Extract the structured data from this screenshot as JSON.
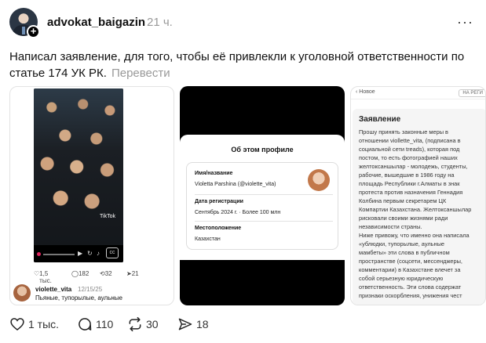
{
  "post": {
    "username": "advokat_baigazin",
    "time": "21 ч.",
    "text": "Написал заявление, для того, чтобы её привлекли к уголовной ответственности по статье 174 УК РК.",
    "translate_label": "Перевести"
  },
  "media1": {
    "watermark": "TikTok",
    "stats": [
      "1,5 тыс.",
      "182",
      "32",
      "21"
    ],
    "reply": {
      "username": "violette_vita",
      "date": "12/15/25",
      "text": "Пьяные, тупорылые, аульные"
    }
  },
  "media2": {
    "title": "Об этом профиле",
    "name_label": "Имя/название",
    "name_value": "Violetta Parshina (@violette_vita)",
    "reg_label": "Дата регистрации",
    "reg_value": "Сентябрь 2024 г. · Более 100 млн",
    "loc_label": "Местоположение",
    "loc_value": "Казахстан"
  },
  "media3": {
    "back_label": "Новое",
    "top_button": "НА РЕГИ",
    "title": "Заявление",
    "body": "Прошу принять законные меры в\nотношении viollette_vita, (подписана в\nсоциальной сети treads), которая под\nпостом, то есть фотографией наших\nжелтоксаншылар - молодежь, студенты,\nрабочие, вышедшие в 1986 году на\nплощадь Республики г.Алматы в знак\nпротеста против назначения Геннадия\nКолбина первым секретарем ЦК\nКомпартии Казахстана. Желтоксаншылар\nрисковали своими жизнями ради\nнезависимости страны.\nНиже привожу, что именно она написала\n«ублюдки, тупорылые, аульные\nмамбеты» эти слова в публичном\nпространстве (соцсети, мессенджеры,\nкомментарии) в Казахстане влечет за\nсобой серьезную юридическую\nответственность. Эти слова содержат\nпризнаки оскорбления, унижения чест"
  },
  "actions": {
    "likes": "1 тыс.",
    "replies": "110",
    "reposts": "30",
    "shares": "18"
  }
}
